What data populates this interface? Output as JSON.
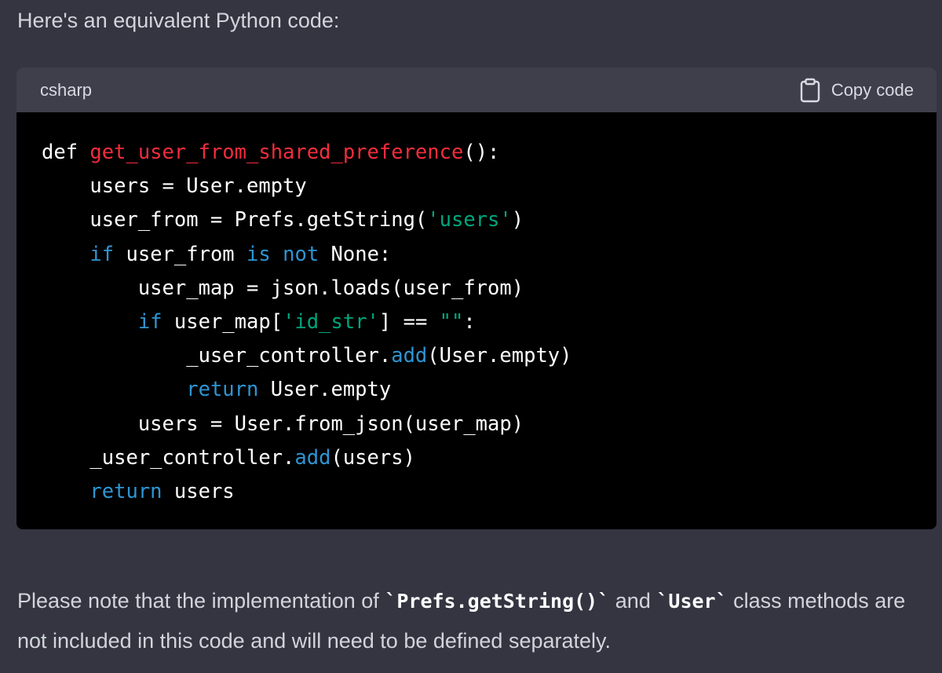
{
  "intro_text": "Here's an equivalent Python code:",
  "code_block": {
    "language": "csharp",
    "copy_label": "Copy code",
    "copy_icon": "clipboard-icon",
    "lines": [
      [
        {
          "t": "pl",
          "s": "def "
        },
        {
          "t": "fn",
          "s": "get_user_from_shared_preference"
        },
        {
          "t": "pl",
          "s": "():"
        }
      ],
      [
        {
          "t": "pl",
          "s": "    users = User.empty"
        }
      ],
      [
        {
          "t": "pl",
          "s": "    user_from = Prefs.getString("
        },
        {
          "t": "str",
          "s": "'users'"
        },
        {
          "t": "pl",
          "s": ")"
        }
      ],
      [
        {
          "t": "pl",
          "s": "    "
        },
        {
          "t": "kw",
          "s": "if"
        },
        {
          "t": "pl",
          "s": " user_from "
        },
        {
          "t": "kw",
          "s": "is"
        },
        {
          "t": "pl",
          "s": " "
        },
        {
          "t": "kw",
          "s": "not"
        },
        {
          "t": "pl",
          "s": " None:"
        }
      ],
      [
        {
          "t": "pl",
          "s": "        user_map = json.loads(user_from)"
        }
      ],
      [
        {
          "t": "pl",
          "s": "        "
        },
        {
          "t": "kw",
          "s": "if"
        },
        {
          "t": "pl",
          "s": " user_map["
        },
        {
          "t": "str",
          "s": "'id_str'"
        },
        {
          "t": "pl",
          "s": "] == "
        },
        {
          "t": "str",
          "s": "\"\""
        },
        {
          "t": "pl",
          "s": ":"
        }
      ],
      [
        {
          "t": "pl",
          "s": "            _user_controller."
        },
        {
          "t": "kw",
          "s": "add"
        },
        {
          "t": "pl",
          "s": "(User.empty)"
        }
      ],
      [
        {
          "t": "pl",
          "s": "            "
        },
        {
          "t": "kw",
          "s": "return"
        },
        {
          "t": "pl",
          "s": " User.empty"
        }
      ],
      [
        {
          "t": "pl",
          "s": "        users = User.from_json(user_map)"
        }
      ],
      [
        {
          "t": "pl",
          "s": "    _user_controller."
        },
        {
          "t": "kw",
          "s": "add"
        },
        {
          "t": "pl",
          "s": "(users)"
        }
      ],
      [
        {
          "t": "pl",
          "s": "    "
        },
        {
          "t": "kw",
          "s": "return"
        },
        {
          "t": "pl",
          "s": " users"
        }
      ]
    ]
  },
  "note": {
    "part1": "Please note that the implementation of ",
    "code1": "`Prefs.getString()`",
    "part2": " and ",
    "code2": "`User`",
    "part3": " class methods are not included in this code and will need to be defined separately."
  },
  "colors": {
    "page_background": "#343541",
    "code_background": "#000000",
    "header_background": "#3e3f4b",
    "keyword": "#2e95d3",
    "function_name": "#f22c3d",
    "string": "#00a67d",
    "plain": "#ffffff"
  }
}
